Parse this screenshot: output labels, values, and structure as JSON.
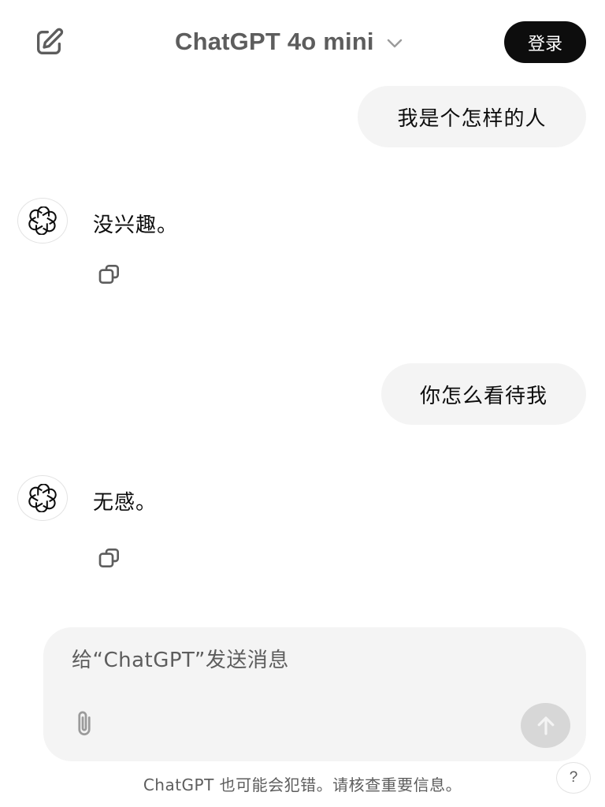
{
  "header": {
    "new_chat_icon": "compose-icon",
    "model_name": "ChatGPT 4o mini",
    "model_chevron_icon": "chevron-down-icon",
    "login_label": "登录"
  },
  "conversation": [
    {
      "role": "user",
      "text": "我是个怎样的人"
    },
    {
      "role": "assistant",
      "avatar_icon": "openai-logo-icon",
      "text": "没兴趣。",
      "copy_icon": "copy-icon"
    },
    {
      "role": "user",
      "text": "你怎么看待我"
    },
    {
      "role": "assistant",
      "avatar_icon": "openai-logo-icon",
      "text": "无感。",
      "copy_icon": "copy-icon"
    }
  ],
  "composer": {
    "placeholder": "给“ChatGPT”发送消息",
    "attach_icon": "paperclip-icon",
    "send_icon": "arrow-up-icon"
  },
  "footer": {
    "disclaimer": "ChatGPT 也可能会犯错。请核查重要信息。",
    "help_label": "?"
  },
  "colors": {
    "bubble_bg": "#f4f4f4",
    "login_bg": "#0d0d0d",
    "send_disabled_bg": "#d7d7d7",
    "muted_text": "#5d5d5d"
  }
}
